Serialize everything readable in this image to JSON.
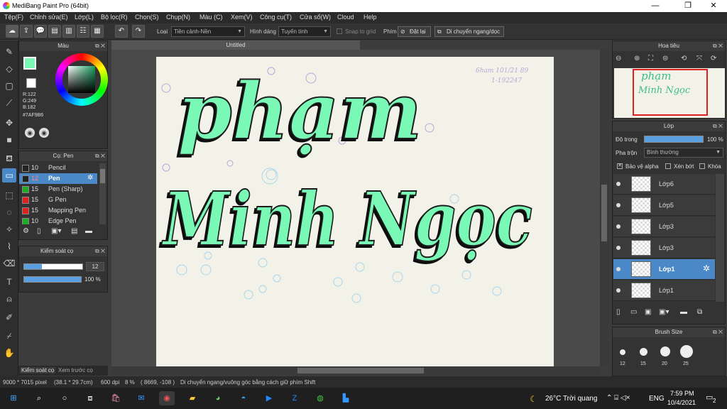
{
  "window": {
    "title": "MediBang Paint Pro (64bit)",
    "minimize": "—",
    "restore": "❐",
    "close": "✕"
  },
  "menu": [
    "Tệp(F)",
    "Chỉnh sửa(E)",
    "Lớp(L)",
    "Bộ lọc(R)",
    "Chọn(S)",
    "Chụp(N)",
    "Màu (C)",
    "Xem(V)",
    "Công cụ(T)",
    "Cửa sổ(W)",
    "Cloud",
    "Help"
  ],
  "toolbar": {
    "type_label": "Loại",
    "type_value": "Tiền cảnh-Nền",
    "shape_label": "Hình dáng",
    "shape_value": "Tuyến tính",
    "snap_label": "Snap to grid",
    "key_label": "Phím",
    "reset_label": "Đặt lại",
    "move_label": "Di chuyển ngang/dọc"
  },
  "color_panel": {
    "title": "Màu",
    "r": "R:122",
    "g": "G:249",
    "b": "B:182",
    "hex": "#7AF9B6",
    "fg_color": "#7AF9B6"
  },
  "brush_panel": {
    "title": "Cọ: Pen",
    "brushes": [
      {
        "size": "10",
        "name": "Pencil",
        "color": "#222222"
      },
      {
        "size": "12",
        "name": "Pen",
        "color": "#222222"
      },
      {
        "size": "15",
        "name": "Pen (Sharp)",
        "color": "#22aa22"
      },
      {
        "size": "15",
        "name": "G Pen",
        "color": "#dd2222"
      },
      {
        "size": "15",
        "name": "Mapping Pen",
        "color": "#dd2222"
      },
      {
        "size": "10",
        "name": "Edge Pen",
        "color": "#22aa22"
      }
    ]
  },
  "brush_control": {
    "title": "Kiểm soát cọ",
    "size": "12",
    "opacity": "100 %",
    "size_fraction": 0.3,
    "opacity_fraction": 1.0
  },
  "left_tabs": {
    "tab1": "Kiểm soát cọ",
    "tab2": "Xem trước cọ"
  },
  "document": {
    "tab_title": "Untitled"
  },
  "canvas_text": {
    "line1": "phạm",
    "line2": "Minh Ngọc",
    "note1": "6ham 101/21 89",
    "note2": "1-192247"
  },
  "navigator": {
    "title": "Hoa tiêu",
    "preview1": "phạm",
    "preview2": "Minh Ngọc"
  },
  "layer_panel": {
    "title": "Lớp",
    "opacity_label": "Độ trong",
    "opacity_value": "100 %",
    "blend_label": "Pha trộn",
    "blend_value": "Bình thường",
    "alpha_lock": "Bảo vệ alpha",
    "clipping": "Xén bớt",
    "lock": "Khóa",
    "layers": [
      {
        "name": "Lớp6"
      },
      {
        "name": "Lớp5"
      },
      {
        "name": "Lớp3"
      },
      {
        "name": "Lớp3"
      },
      {
        "name": "Lớp1"
      },
      {
        "name": "Lớp1"
      }
    ]
  },
  "brush_size_panel": {
    "title": "Brush Size",
    "sizes": [
      "12",
      "15",
      "20",
      "25"
    ]
  },
  "status": {
    "dimensions": "9000 * 7015 pixel",
    "cm": "(38.1 * 29.7cm)",
    "dpi": "600 dpi",
    "zoom": "8 %",
    "coords": "( 8669, -108 )",
    "hint": "Di chuyển ngang/vuông góc bằng cách giữ phím Shift"
  },
  "taskbar": {
    "weather": "26°C Trời quang",
    "lang": "ENG",
    "time": "7:59 PM",
    "date": "10/4/2021",
    "notif": "2"
  }
}
